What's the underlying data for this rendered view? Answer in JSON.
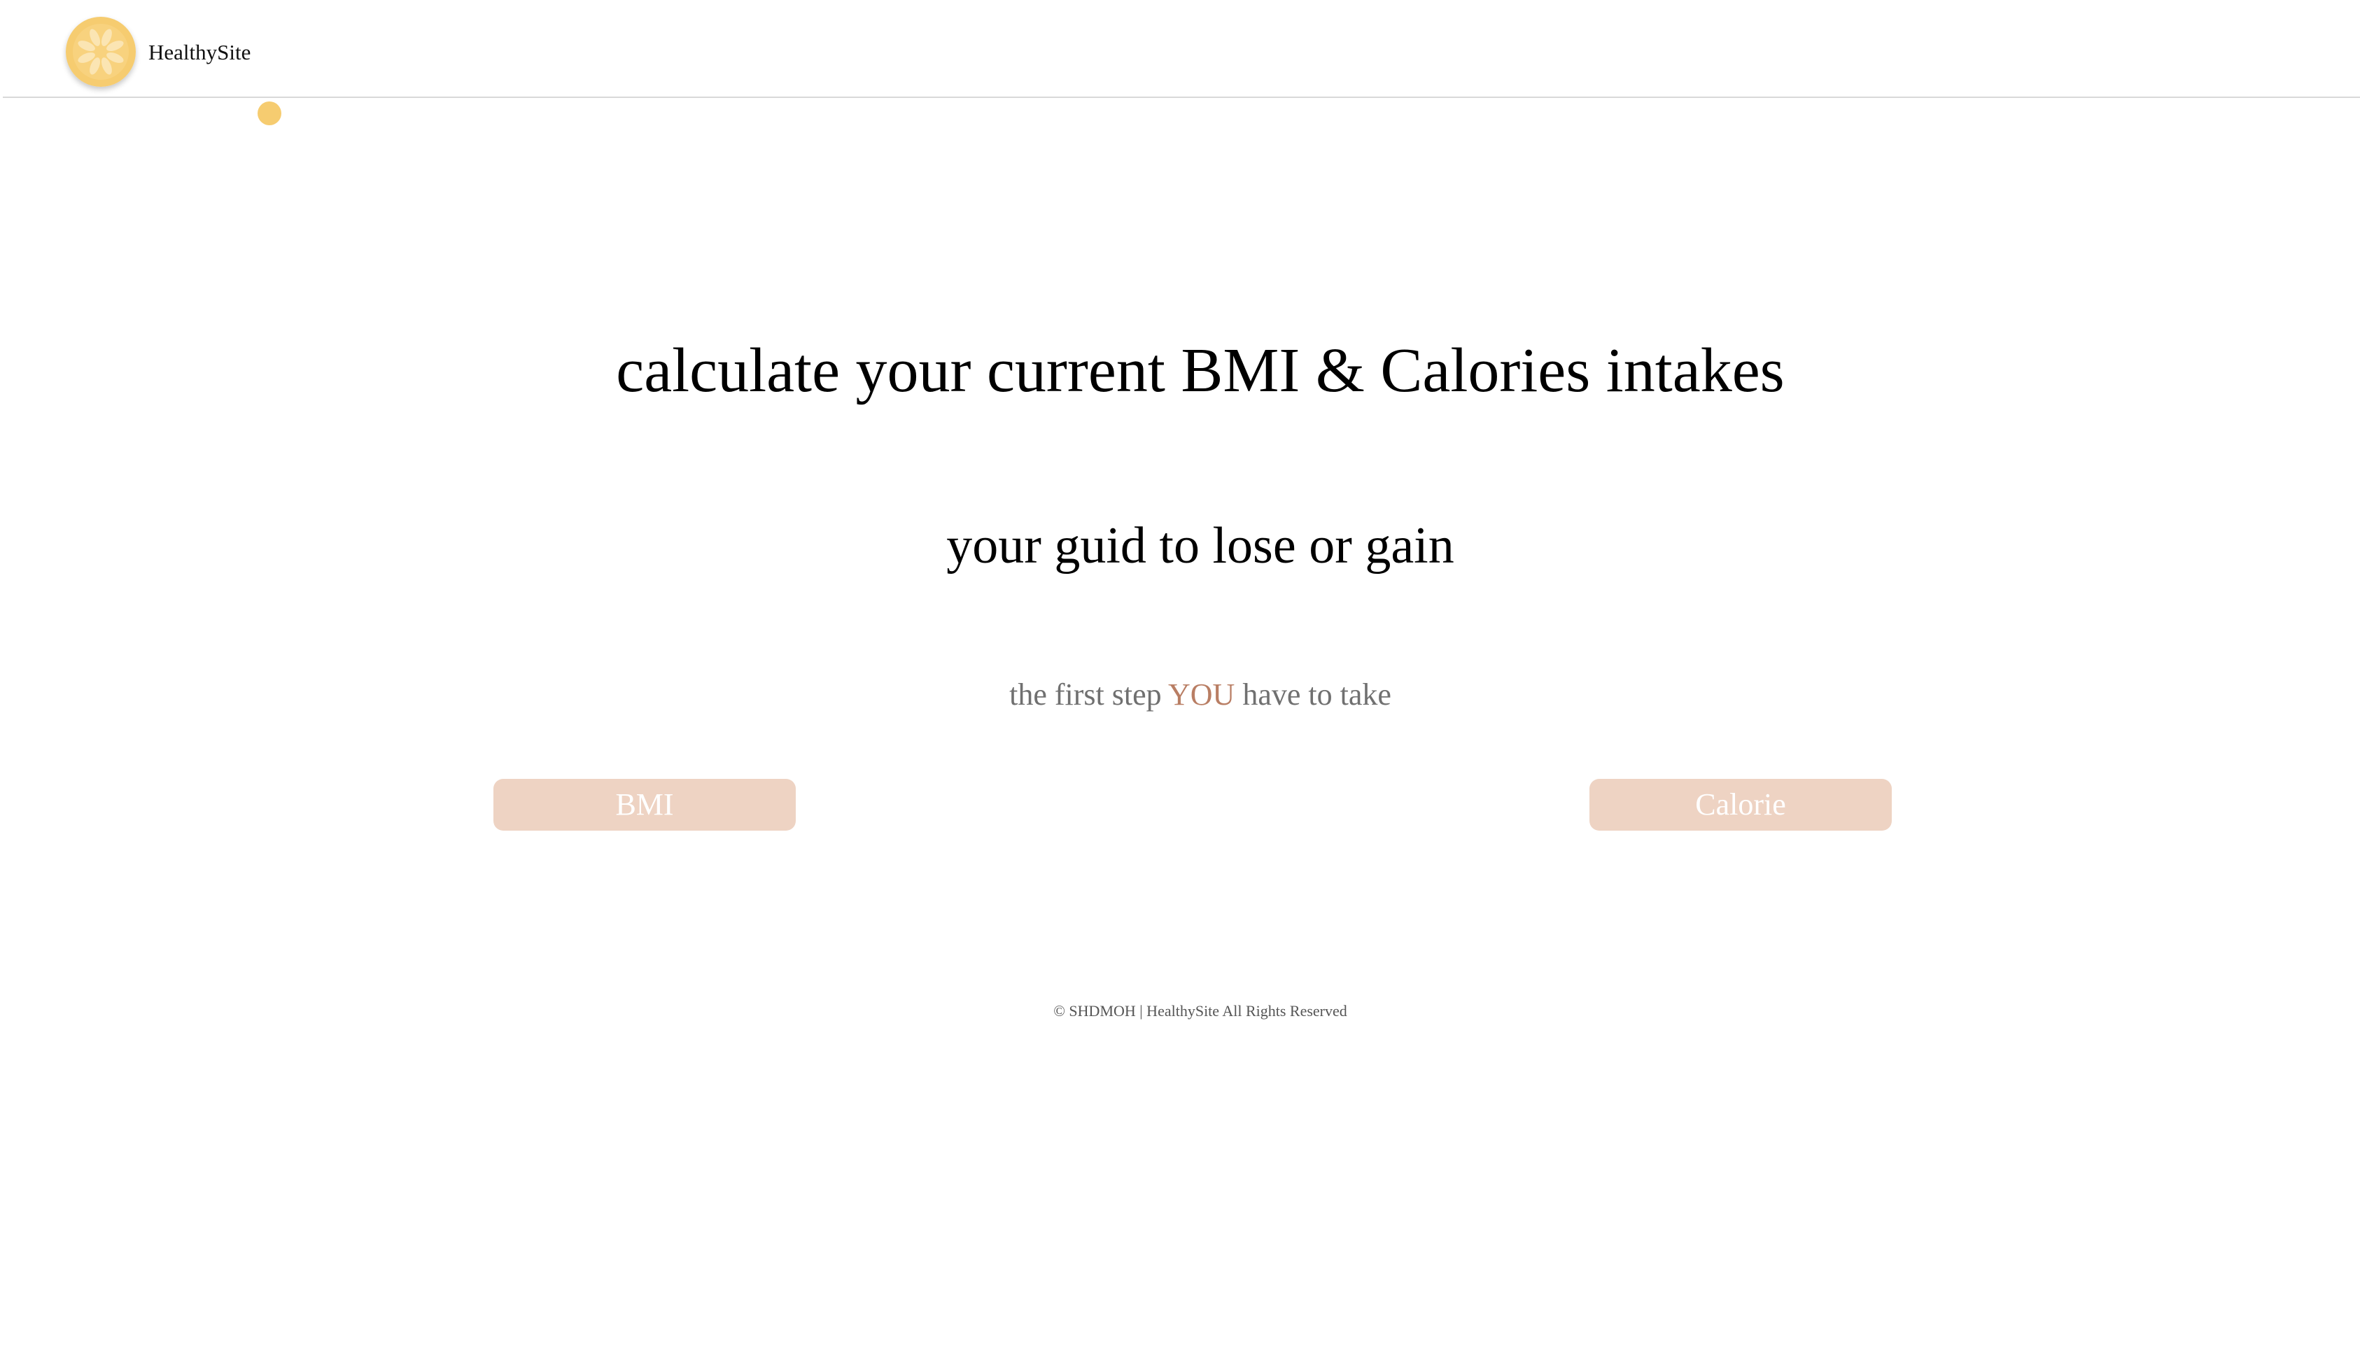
{
  "colors": {
    "accent": "#f6cc70",
    "accent_light": "#fbe5b3",
    "button_bg": "#eed3c3",
    "highlight": "#b97e64",
    "muted_text": "#707070",
    "footer_text": "#555555"
  },
  "header": {
    "logo_icon": "lemon-slice-icon",
    "brand": "HealthySite"
  },
  "hero": {
    "title": "calculate your current BMI & Calories intakes",
    "subtitle": "your guid to lose or gain",
    "tagline": {
      "before": "the first step ",
      "highlight": "YOU",
      "after": " have to take"
    }
  },
  "buttons": {
    "bmi": "BMI",
    "calorie": "Calorie"
  },
  "footer": {
    "text": "© SHDMOH | HealthySite All Rights Reserved"
  }
}
